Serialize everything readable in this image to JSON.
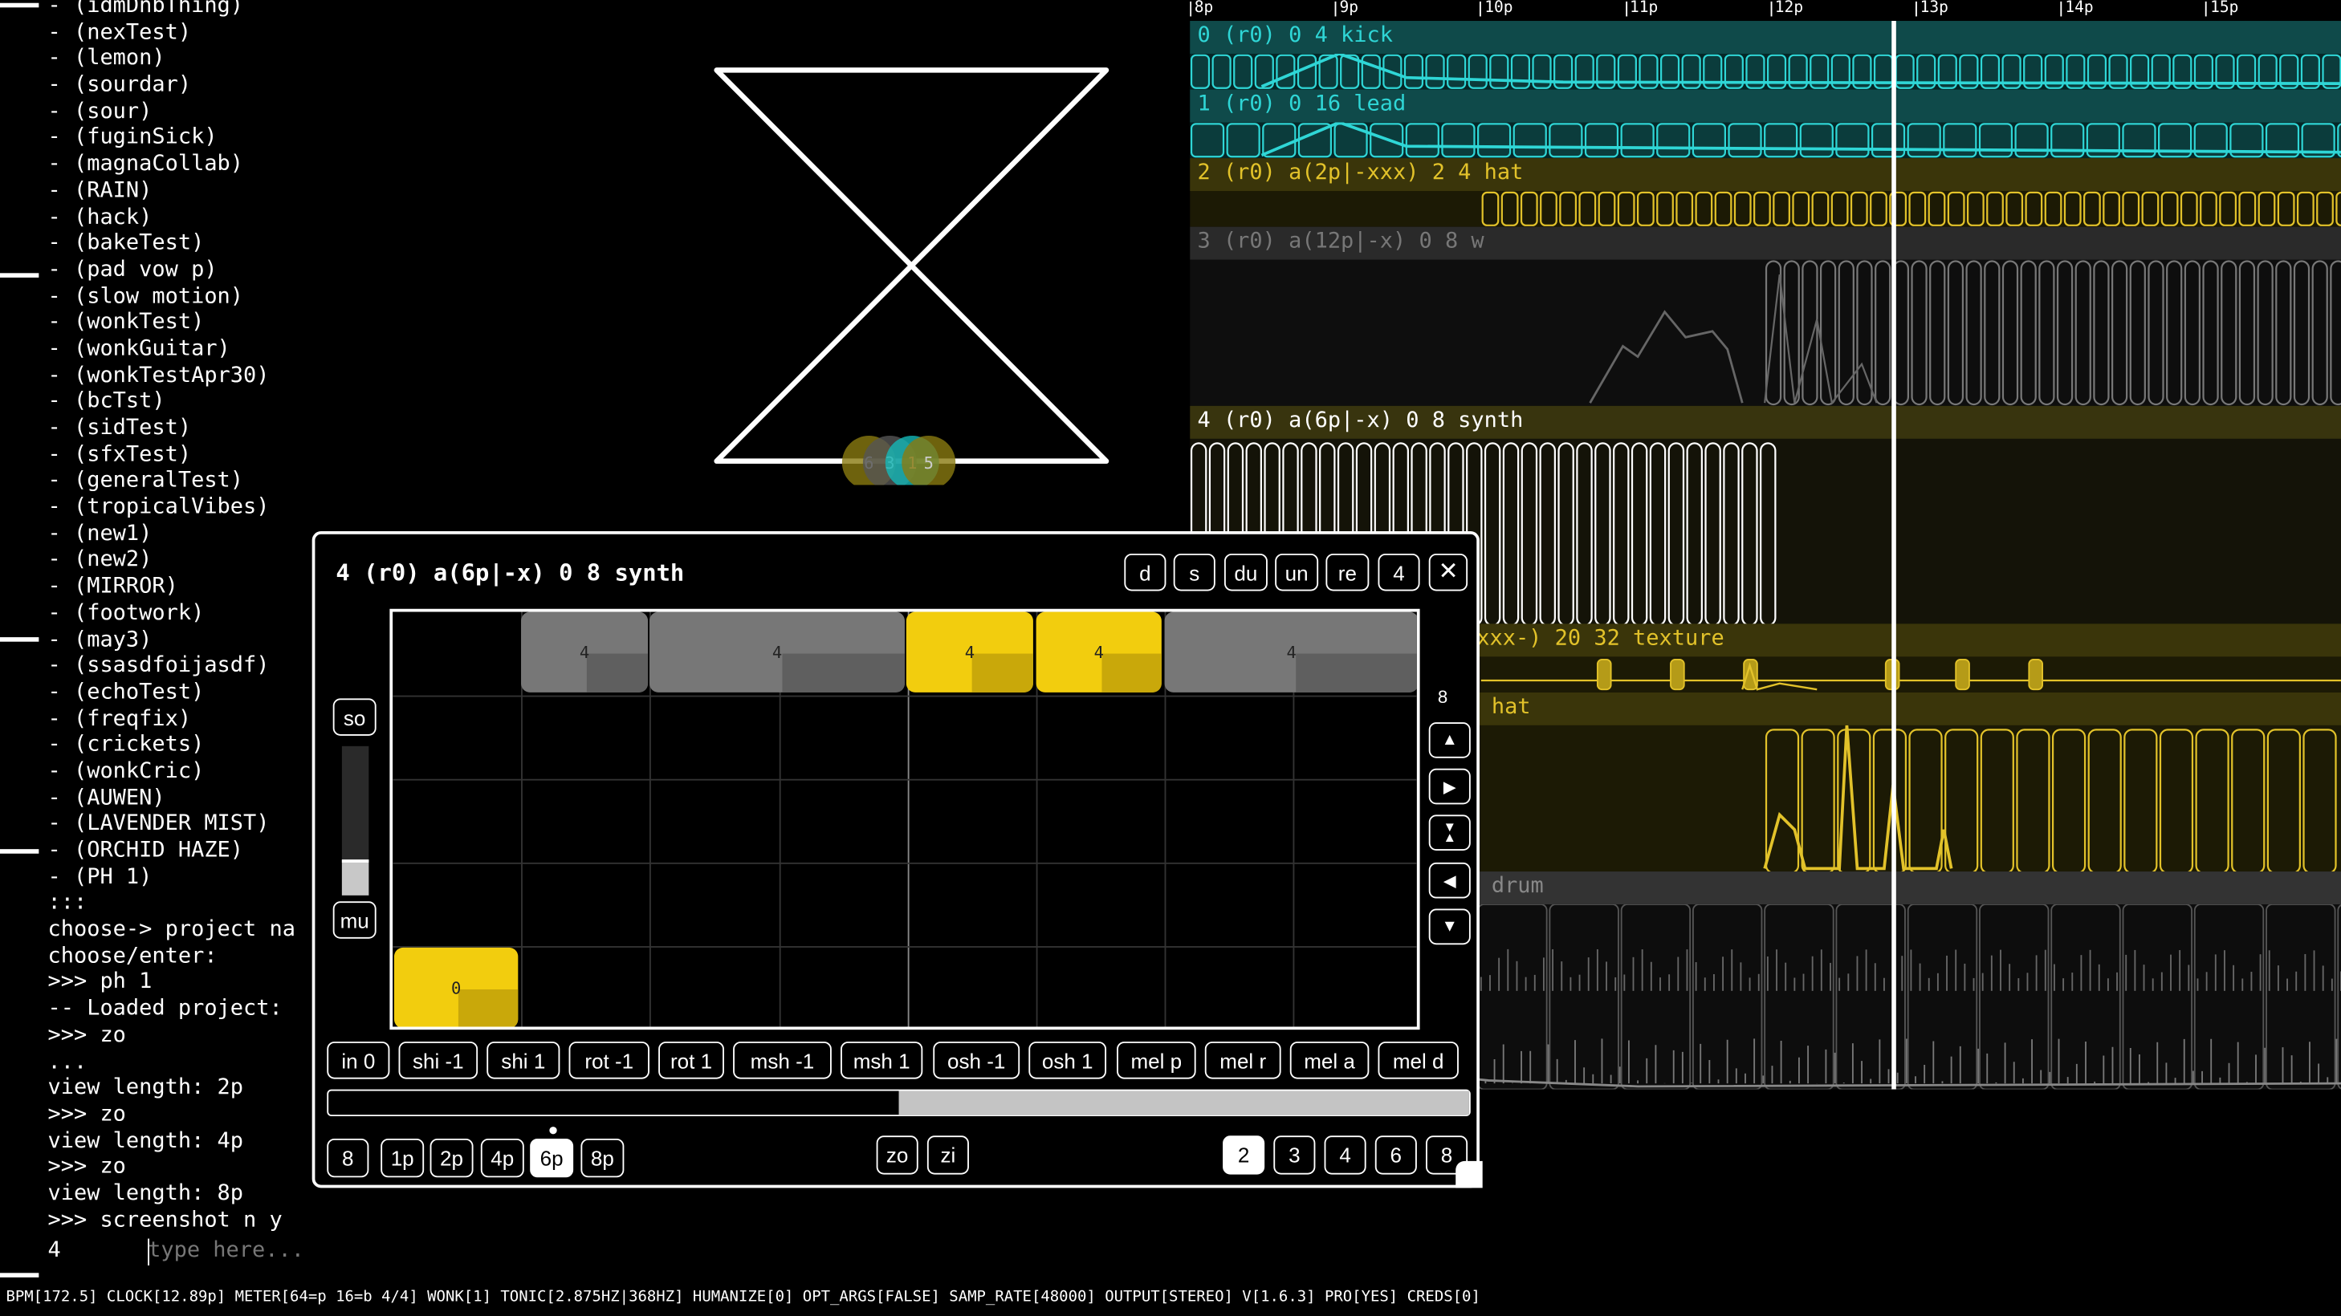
{
  "console": {
    "lines": [
      "- (idmDnbThing)",
      "- (nexTest)",
      "- (lemon)",
      "- (sourdar)",
      "- (sour)",
      "- (fuginSick)",
      "- (magnaCollab)",
      "- (RAIN)",
      "- (hack)",
      "- (bakeTest)",
      "- (pad vow p)",
      "- (slow motion)",
      "- (wonkTest)",
      "- (wonkGuitar)",
      "- (wonkTestApr30)",
      "- (bcTst)",
      "- (sidTest)",
      "- (sfxTest)",
      "- (generalTest)",
      "- (tropicalVibes)",
      "- (new1)",
      "- (new2)",
      "- (MIRROR)",
      "- (footwork)",
      "- (may3)",
      "- (ssasdfoijasdf)",
      "- (echoTest)",
      "- (freqfix)",
      "- (crickets)",
      "- (wonkCric)",
      "- (AUWEN)",
      "- (LAVENDER MIST)",
      "- (ORCHID HAZE)",
      "- (PH 1)",
      ":::",
      "choose-> project na",
      "choose/enter:",
      ">>> ph 1",
      "-- Loaded project:",
      ">>> zo",
      "...",
      "view length: 2p",
      ">>> zo",
      "view length: 4p",
      ">>> zo",
      "view length: 8p",
      ">>> screenshot n y"
    ],
    "prompt_number": "4",
    "input_placeholder": "type here..."
  },
  "status_bar": "BPM[172.5] CLOCK[12.89p] METER[64=p 16=b 4/4] WONK[1] TONIC[2.875HZ|368HZ] HUMANIZE[0] OPT_ARGS[FALSE] SAMP_RATE[48000] OUTPUT[STEREO] V[1.6.3] PRO[YES] CREDS[0]",
  "viz": {
    "circles": [
      {
        "label": "6",
        "color": "#8a7a10"
      },
      {
        "label": "3",
        "color": "#555555"
      },
      {
        "label": "1",
        "color": "#14b8b8"
      },
      {
        "label": "5",
        "color": "#8a7a10"
      }
    ]
  },
  "timeline": {
    "ruler": [
      "8p",
      "9p",
      "10p",
      "11p",
      "12p",
      "13p",
      "14p",
      "15p"
    ],
    "tracks": [
      {
        "title": "0 (r0) 0 4 kick",
        "color": "#2fd6d6"
      },
      {
        "title": "1 (r0) 0 16 lead",
        "color": "#2fd6d6"
      },
      {
        "title": "2 (r0) a(2p|-xxx) 2 4 hat",
        "color": "#e2c22a"
      },
      {
        "title": "3 (r0) a(12p|-x) 0 8 w",
        "color": "#777777"
      },
      {
        "title": "4 (r0) a(6p|-x) 0 8 synth",
        "color": "#ffffff"
      },
      {
        "title": "xxx-) 20 32 texture",
        "color": "#e2c22a"
      },
      {
        "title": "hat",
        "color": "#e2c22a"
      },
      {
        "title": "drum",
        "color": "#888888"
      }
    ]
  },
  "modal": {
    "title": "4 (r0) a(6p|-x) 0 8 synth",
    "header_buttons": [
      "d",
      "s",
      "du",
      "un",
      "re",
      "4"
    ],
    "close_icon": "close-icon",
    "solo_label": "so",
    "mute_label": "mu",
    "volume_level": 0.22,
    "row_count_label": "8",
    "notes": [
      {
        "label": "4",
        "color": "gray"
      },
      {
        "label": "4",
        "color": "gray"
      },
      {
        "label": "4",
        "color": "yellow"
      },
      {
        "label": "4",
        "color": "yellow"
      },
      {
        "label": "4",
        "color": "gray"
      },
      {
        "label": "0",
        "color": "yellow"
      }
    ],
    "ops_buttons": [
      "in 0",
      "shi -1",
      "shi 1",
      "rot -1",
      "rot 1",
      "msh -1",
      "msh 1",
      "osh -1",
      "osh 1",
      "mel p",
      "mel r",
      "mel a",
      "mel d"
    ],
    "scroll_position": 0.5,
    "length_buttons": [
      "8",
      "1p",
      "2p",
      "4p",
      "6p",
      "8p"
    ],
    "length_selected": "6p",
    "zoom_buttons": [
      "zo",
      "zi"
    ],
    "division_buttons": [
      "2",
      "3",
      "4",
      "6",
      "8"
    ],
    "division_selected": "2"
  }
}
